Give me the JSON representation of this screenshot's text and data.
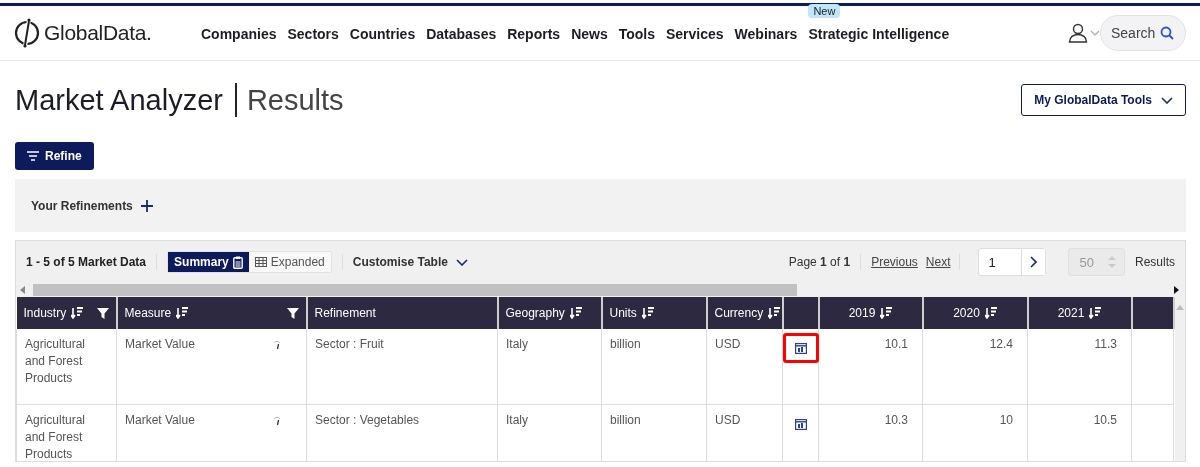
{
  "header": {
    "logo": "GlobalData.",
    "nav": [
      {
        "label": "Companies"
      },
      {
        "label": "Sectors"
      },
      {
        "label": "Countries"
      },
      {
        "label": "Databases"
      },
      {
        "label": "Reports"
      },
      {
        "label": "News"
      },
      {
        "label": "Tools"
      },
      {
        "label": "Services"
      },
      {
        "label": "Webinars"
      },
      {
        "label": "Strategic Intelligence",
        "badge": "New"
      }
    ],
    "search": {
      "placeholder": "Search"
    }
  },
  "page": {
    "title": "Market Analyzer",
    "subtitle": "Results",
    "tools_button": "My GlobalData Tools",
    "refine_button": "Refine"
  },
  "refinements": {
    "label": "Your Refinements"
  },
  "toolbar": {
    "count": "1 - 5 of 5 Market Data",
    "views": [
      {
        "label": "Summary",
        "selected": true
      },
      {
        "label": "Expanded",
        "selected": false
      }
    ],
    "customise": "Customise Table",
    "page_info": "Page **1** of **1**",
    "previous": "Previous",
    "next": "Next",
    "page_value": "1",
    "page_size": "50",
    "results_label": "Results"
  },
  "table": {
    "columns": [
      {
        "kind": "text",
        "label": "Industry",
        "sortable": true,
        "filterable": true
      },
      {
        "kind": "text",
        "label": "Measure",
        "sortable": true,
        "filterable": true,
        "info": true
      },
      {
        "kind": "text",
        "label": "Refinement",
        "sortable": false,
        "filterable": false
      },
      {
        "kind": "text",
        "label": "Geography",
        "sortable": true,
        "filterable": false
      },
      {
        "kind": "text",
        "label": "Units",
        "sortable": true,
        "filterable": false
      },
      {
        "kind": "text",
        "label": "Currency",
        "sortable": true,
        "filterable": false
      },
      {
        "kind": "icon",
        "sortable": false,
        "filterable": false
      },
      {
        "kind": "number",
        "label": "2019",
        "sortable": true,
        "filterable": false
      },
      {
        "kind": "number",
        "label": "2020",
        "sortable": true,
        "filterable": false
      },
      {
        "kind": "number",
        "label": "2021",
        "sortable": true,
        "filterable": false
      },
      {
        "kind": "blank",
        "sortable": false,
        "filterable": false
      }
    ],
    "rows": [
      {
        "values": [
          "Agricultural and Forest Products",
          "Market Value",
          "Sector : Fruit",
          "Italy",
          "billion",
          "USD"
        ],
        "numbers": [
          "10.1",
          "12.4",
          "11.3"
        ],
        "chart_highlighted": true
      },
      {
        "values": [
          "Agricultural and Forest Products",
          "Market Value",
          "Sector : Vegetables",
          "Italy",
          "billion",
          "USD"
        ],
        "numbers": [
          "10.3",
          "10",
          "10.5"
        ],
        "chart_highlighted": false
      }
    ]
  }
}
